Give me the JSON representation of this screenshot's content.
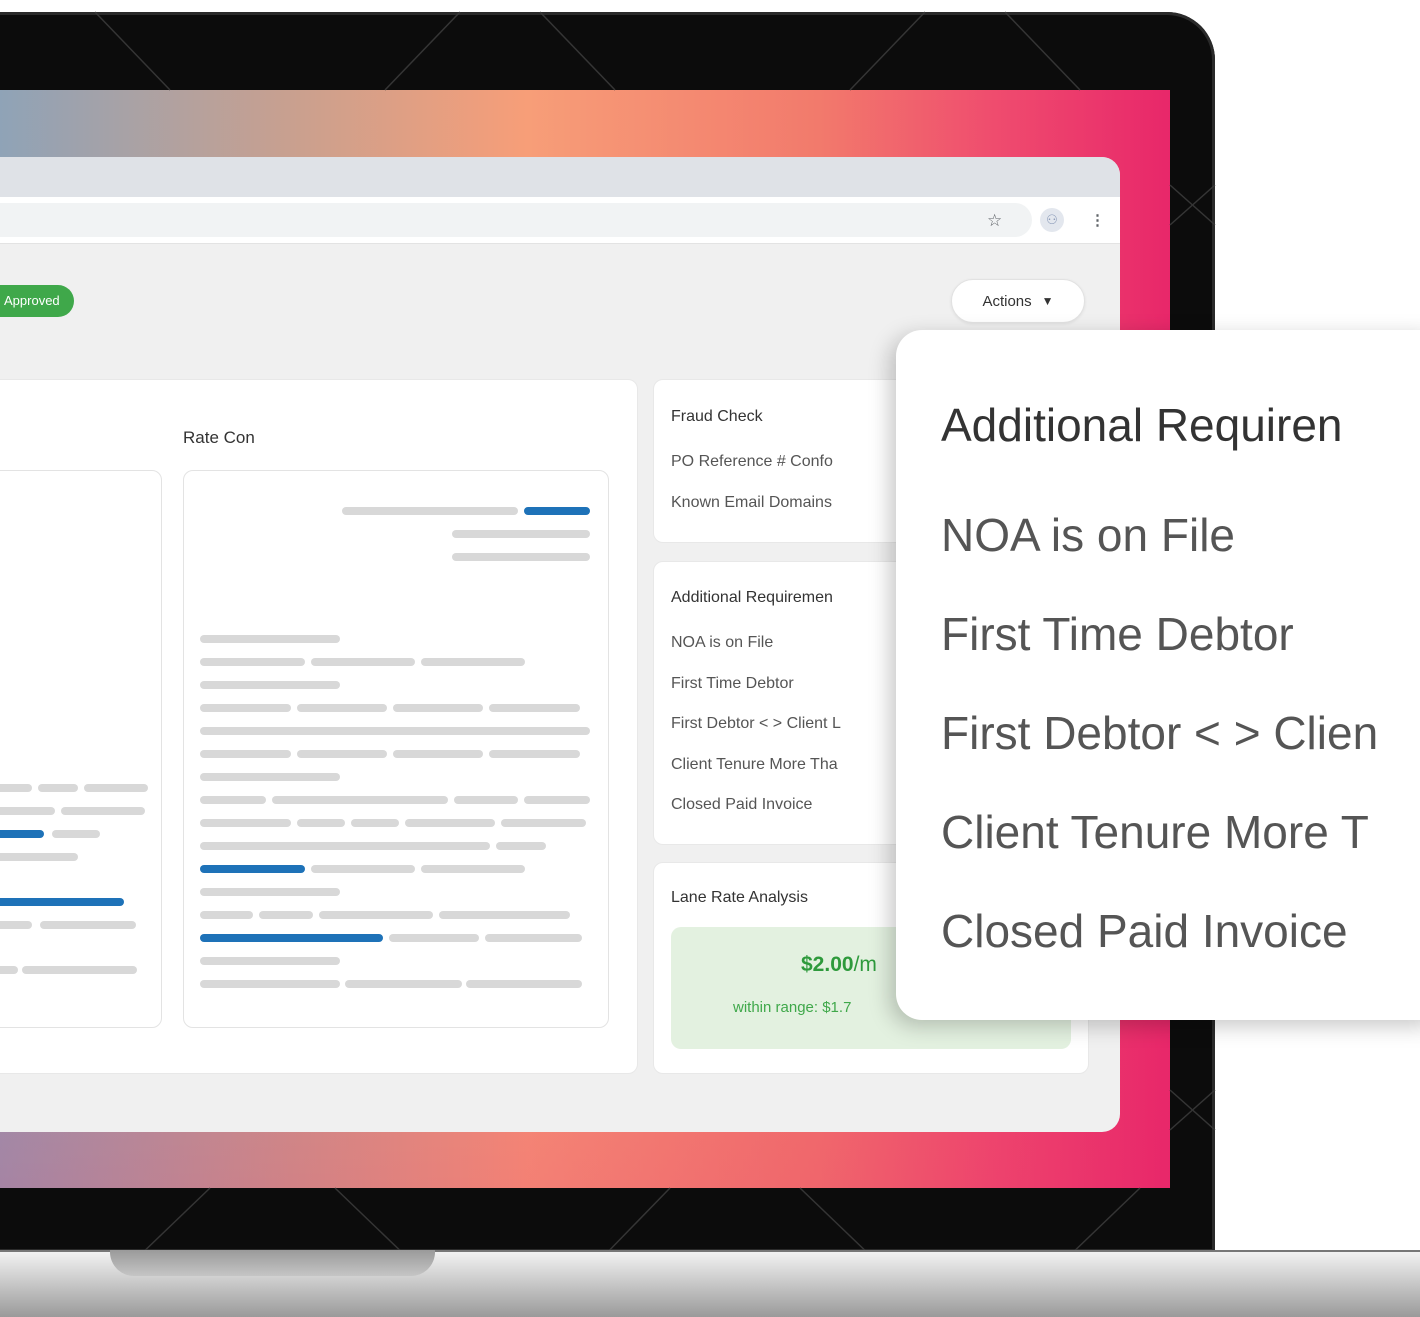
{
  "browser": {
    "icons": {
      "bookmark": "star-icon",
      "profile": "profile-icon",
      "menu": "more-vert-icon"
    }
  },
  "header": {
    "status_badge": "Approved",
    "actions_label": "Actions"
  },
  "documents": {
    "rate_con_title": "Rate Con"
  },
  "fraud_check": {
    "title": "Fraud Check",
    "items": [
      "PO Reference # Confo",
      "Known Email Domains"
    ]
  },
  "additional_requirements": {
    "title": "Additional Requiremen",
    "items": [
      "NOA is on File",
      "First Time Debtor",
      "First Debtor < > Client L",
      "Client Tenure More Tha",
      "Closed Paid Invoice"
    ]
  },
  "lane_rate": {
    "title": "Lane Rate Analysis",
    "value": "$2.00",
    "unit": "/m",
    "range": "within range: $1.7"
  },
  "callout": {
    "title": "Additional Requiren",
    "items": [
      "NOA is on File",
      "First Time Debtor",
      "First Debtor < > Clien",
      "Client Tenure More T",
      "Closed Paid Invoice"
    ]
  },
  "colors": {
    "approved": "#3fa84a",
    "accent_blue": "#1e72b8",
    "gradient_start": "#8fa3b7",
    "gradient_end": "#e8276a"
  }
}
